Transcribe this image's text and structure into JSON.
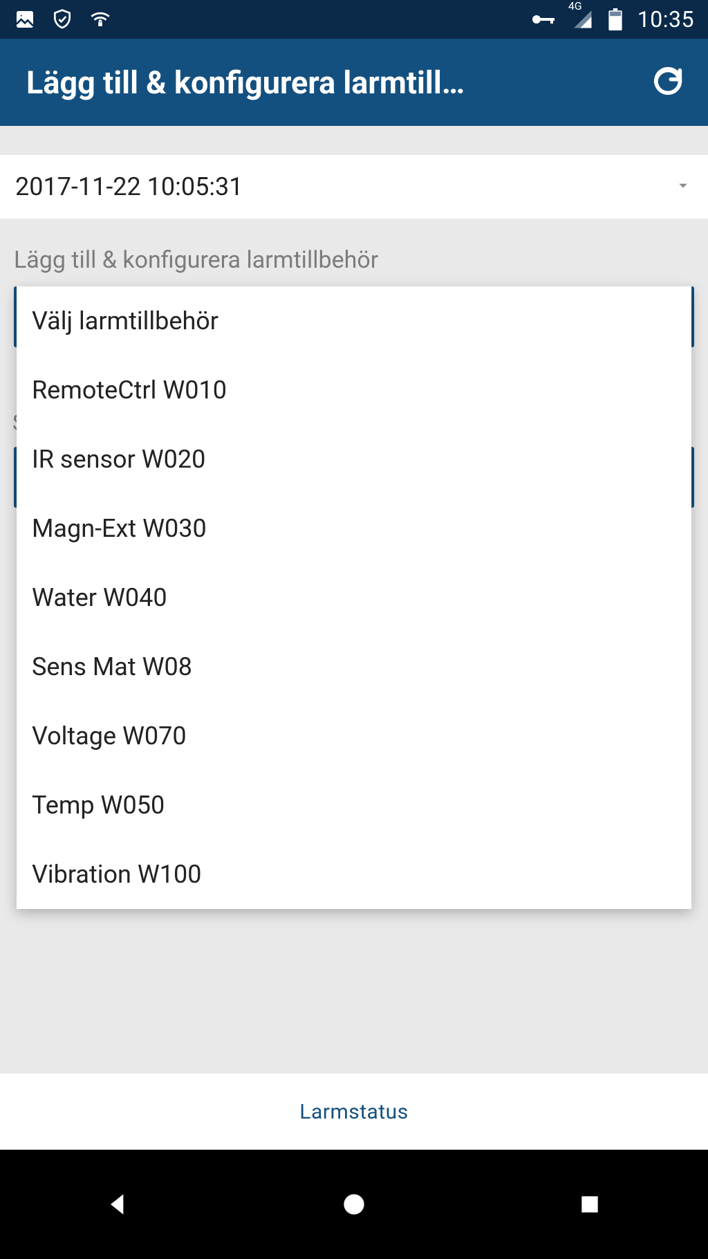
{
  "status": {
    "time": "10:35",
    "network_label": "4G"
  },
  "appbar": {
    "title": "Lägg till & konfigurera larmtill…"
  },
  "date_row": {
    "value": "2017-11-22 10:05:31"
  },
  "section": {
    "label": "Lägg till & konfigurera larmtillbehör"
  },
  "dropdown": {
    "options": [
      "Välj larmtillbehör",
      "RemoteCtrl W010",
      "IR sensor W020",
      "Magn-Ext W030",
      "Water W040",
      "Sens Mat W08",
      "Voltage W070",
      "Temp W050",
      "Vibration W100"
    ]
  },
  "bottom_nav": {
    "label": "Larmstatus"
  },
  "colors": {
    "status_bar_bg": "#0b2a4a",
    "app_bar_bg": "#14507f",
    "page_bg": "#e9e9e9",
    "accent": "#14507f"
  }
}
